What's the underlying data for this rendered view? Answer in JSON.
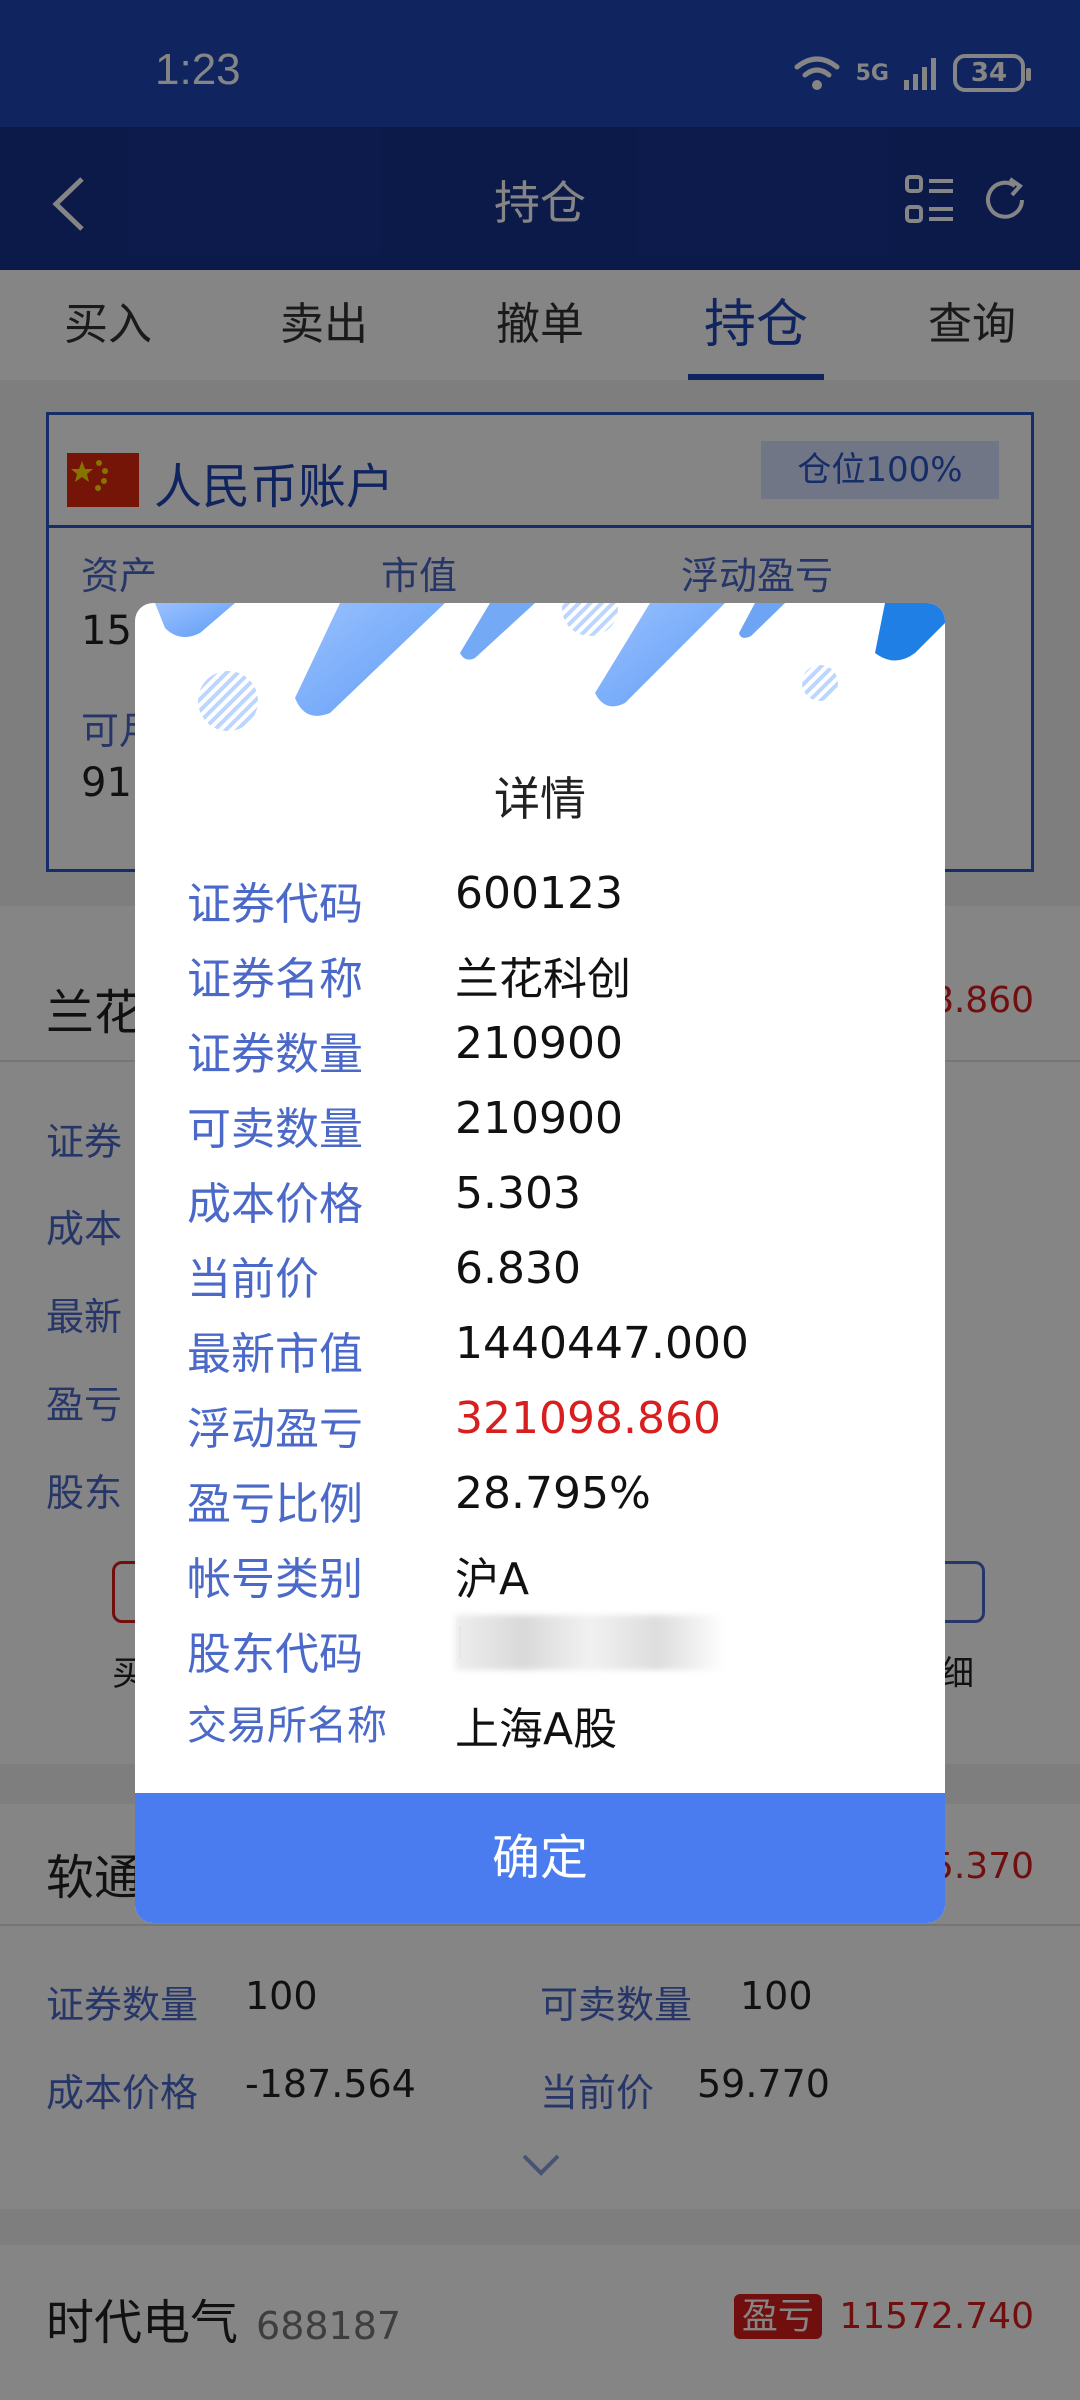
{
  "status": {
    "time": "1:23",
    "network": "5G",
    "battery": "34"
  },
  "nav": {
    "title": "持仓"
  },
  "tabs": [
    {
      "label": "买入"
    },
    {
      "label": "卖出"
    },
    {
      "label": "撤单"
    },
    {
      "label": "持仓",
      "active": true
    },
    {
      "label": "查询"
    }
  ],
  "account": {
    "title": "人民币账户",
    "position_badge": "仓位100%",
    "labels": [
      "资产",
      "市值",
      "浮动盈亏"
    ],
    "asset_partial": "15",
    "available_label_partial": "可月",
    "available_partial": "91"
  },
  "stock1": {
    "name_partial": "兰花",
    "pnl_partial": "8.860",
    "row_labels_partial": [
      "证券",
      "成本",
      "最新",
      "盈亏",
      "股东"
    ],
    "right_partial": "0",
    "action_left_partial": "买",
    "action_right_partial": "细"
  },
  "stock2": {
    "name_partial": "软通",
    "pnl_partial": "5.370",
    "qty_label": "证券数量",
    "qty": "100",
    "sellable_label": "可卖数量",
    "sellable": "100",
    "cost_label": "成本价格",
    "cost": "-187.564",
    "price_label": "当前价",
    "price": "59.770"
  },
  "stock3": {
    "name": "时代电气",
    "code": "688187",
    "badge": "盈亏",
    "pnl": "11572.740"
  },
  "dialog": {
    "title": "详情",
    "rows": [
      {
        "label": "证券代码",
        "value": "600123"
      },
      {
        "label": "证券名称",
        "value": "兰花科创"
      },
      {
        "label": "证券数量",
        "value": "210900"
      },
      {
        "label": "可卖数量",
        "value": "210900"
      },
      {
        "label": "成本价格",
        "value": "5.303"
      },
      {
        "label": "当前价",
        "value": "6.830"
      },
      {
        "label": "最新市值",
        "value": "1440447.000"
      },
      {
        "label": "浮动盈亏",
        "value": "321098.860"
      },
      {
        "label": "盈亏比例",
        "value": "28.795%"
      },
      {
        "label": "帐号类别",
        "value": "沪A"
      },
      {
        "label": "股东代码",
        "value": "E"
      },
      {
        "label": "交易所名称",
        "value": "上海A股"
      }
    ],
    "confirm": "确定"
  },
  "colors": {
    "status_bar": "#1f46b8",
    "nav_bar": "#17338f",
    "accent": "#4a7cf0",
    "profit": "#d81e1e",
    "label": "#4b69c8"
  }
}
